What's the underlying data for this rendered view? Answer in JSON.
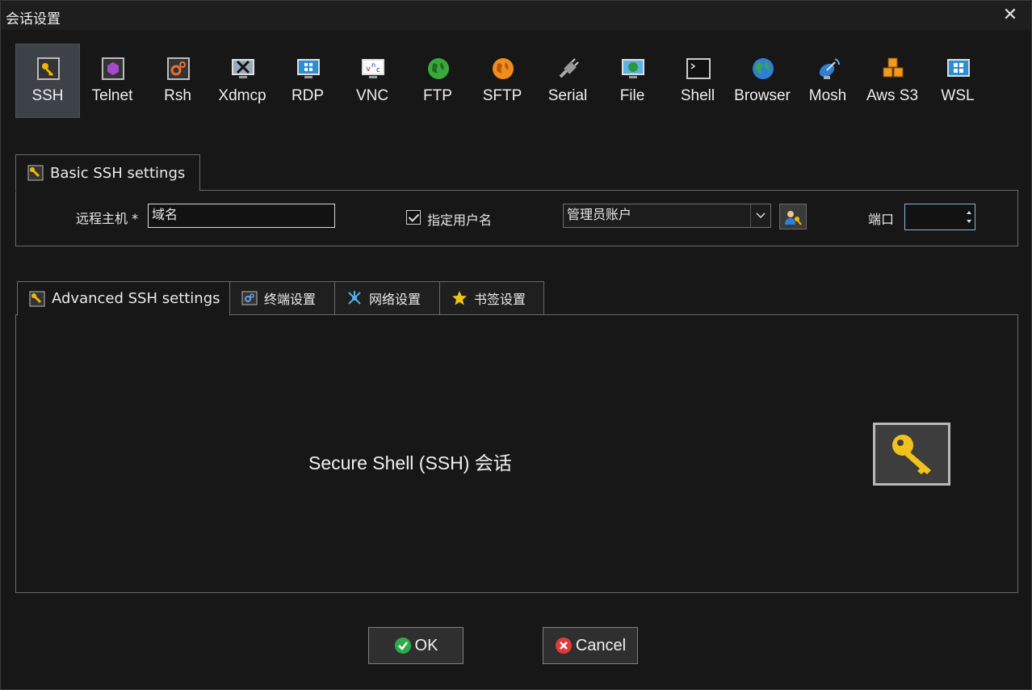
{
  "window": {
    "title": "会话设置",
    "close_glyph": "✕"
  },
  "protocols": [
    {
      "label": "SSH",
      "icon": "ssh-key-icon",
      "active": true
    },
    {
      "label": "Telnet",
      "icon": "telnet-icon"
    },
    {
      "label": "Rsh",
      "icon": "rsh-gears-icon"
    },
    {
      "label": "Xdmcp",
      "icon": "xdmcp-monitor-icon"
    },
    {
      "label": "RDP",
      "icon": "rdp-windows-monitor-icon"
    },
    {
      "label": "VNC",
      "icon": "vnc-icon"
    },
    {
      "label": "FTP",
      "icon": "ftp-globe-icon"
    },
    {
      "label": "SFTP",
      "icon": "sftp-globe-icon"
    },
    {
      "label": "Serial",
      "icon": "serial-plug-icon"
    },
    {
      "label": "File",
      "icon": "file-monitor-icon"
    },
    {
      "label": "Shell",
      "icon": "shell-terminal-icon"
    },
    {
      "label": "Browser",
      "icon": "browser-globe-icon"
    },
    {
      "label": "Mosh",
      "icon": "mosh-satellite-icon"
    },
    {
      "label": "Aws S3",
      "icon": "aws-s3-cubes-icon"
    },
    {
      "label": "WSL",
      "icon": "wsl-windows-icon"
    }
  ],
  "basic": {
    "tab_label": "Basic SSH settings",
    "remote_host_label": "远程主机 *",
    "remote_host_value": "域名",
    "specify_user_label": "指定用户名",
    "specify_user_checked": true,
    "username_value": "管理员账户",
    "port_label": "端口",
    "port_value": ""
  },
  "advanced_tabs": [
    {
      "label": "Advanced SSH settings",
      "icon": "wrench-icon",
      "active": true
    },
    {
      "label": "终端设置",
      "icon": "terminal-gears-icon"
    },
    {
      "label": "网络设置",
      "icon": "network-icon"
    },
    {
      "label": "书签设置",
      "icon": "star-icon"
    }
  ],
  "description": "Secure Shell (SSH) 会话",
  "buttons": {
    "ok": "OK",
    "cancel": "Cancel"
  },
  "colors": {
    "accent_yellow": "#f2b705",
    "ok_green": "#2eaa4a",
    "cancel_red": "#e03a3a"
  }
}
